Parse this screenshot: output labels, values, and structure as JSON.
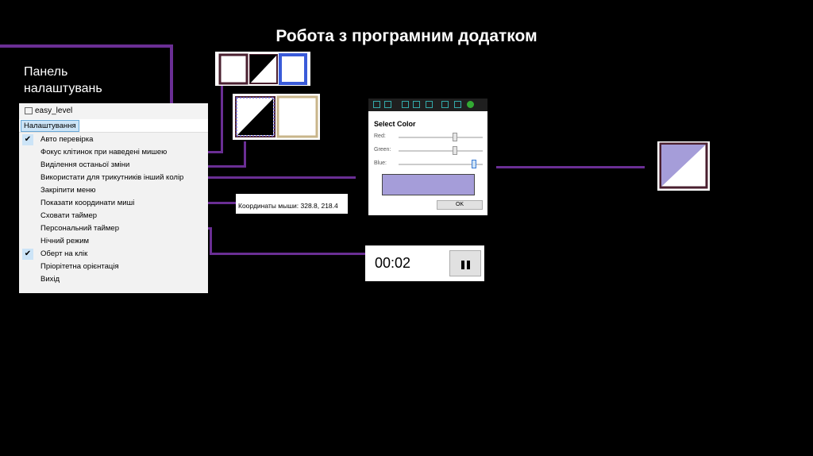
{
  "slide": {
    "title": "Робота з програмним додатком",
    "panel_label_line1": "Панель",
    "panel_label_line2": "налаштувань"
  },
  "window": {
    "title": "easy_level",
    "menu_tab": "Налаштування",
    "items": [
      {
        "label": "Авто перевірка",
        "checked": true
      },
      {
        "label": "Фокус клітинок при наведені мишею",
        "checked": false
      },
      {
        "label": "Виділення останьої зміни",
        "checked": false
      },
      {
        "label": "Використати для трикутників інший колір",
        "checked": false
      },
      {
        "label": "Закріпити меню",
        "checked": false
      },
      {
        "label": "Показати координати миші",
        "checked": false
      },
      {
        "label": "Сховати таймер",
        "checked": false
      },
      {
        "label": "Персональний таймер",
        "checked": false
      },
      {
        "label": "Нічний режим",
        "checked": false
      },
      {
        "label": "Оберт на клік",
        "checked": true
      },
      {
        "label": "Пріорітетна орієнтація",
        "checked": false
      },
      {
        "label": "Вихід",
        "checked": false
      }
    ]
  },
  "color_picker": {
    "title": "Select Color",
    "red_label": "Red:",
    "green_label": "Green:",
    "blue_label": "Blue:",
    "ok_label": "OK",
    "red_level": 0.65,
    "green_level": 0.65,
    "blue_level": 0.85,
    "preview_color": "#a59dd9"
  },
  "coordinates": {
    "text": "Координаты мыши: 328.8, 218.4"
  },
  "timer": {
    "time": "00:02"
  },
  "colors": {
    "accent_line": "#6a2e94",
    "triangle_color": "#a59dd9",
    "highlight_blue": "#3a5bd9",
    "cell_border": "#4a1f2f",
    "hover_border": "#c8b58a",
    "check_bg": "#cce4f7"
  }
}
